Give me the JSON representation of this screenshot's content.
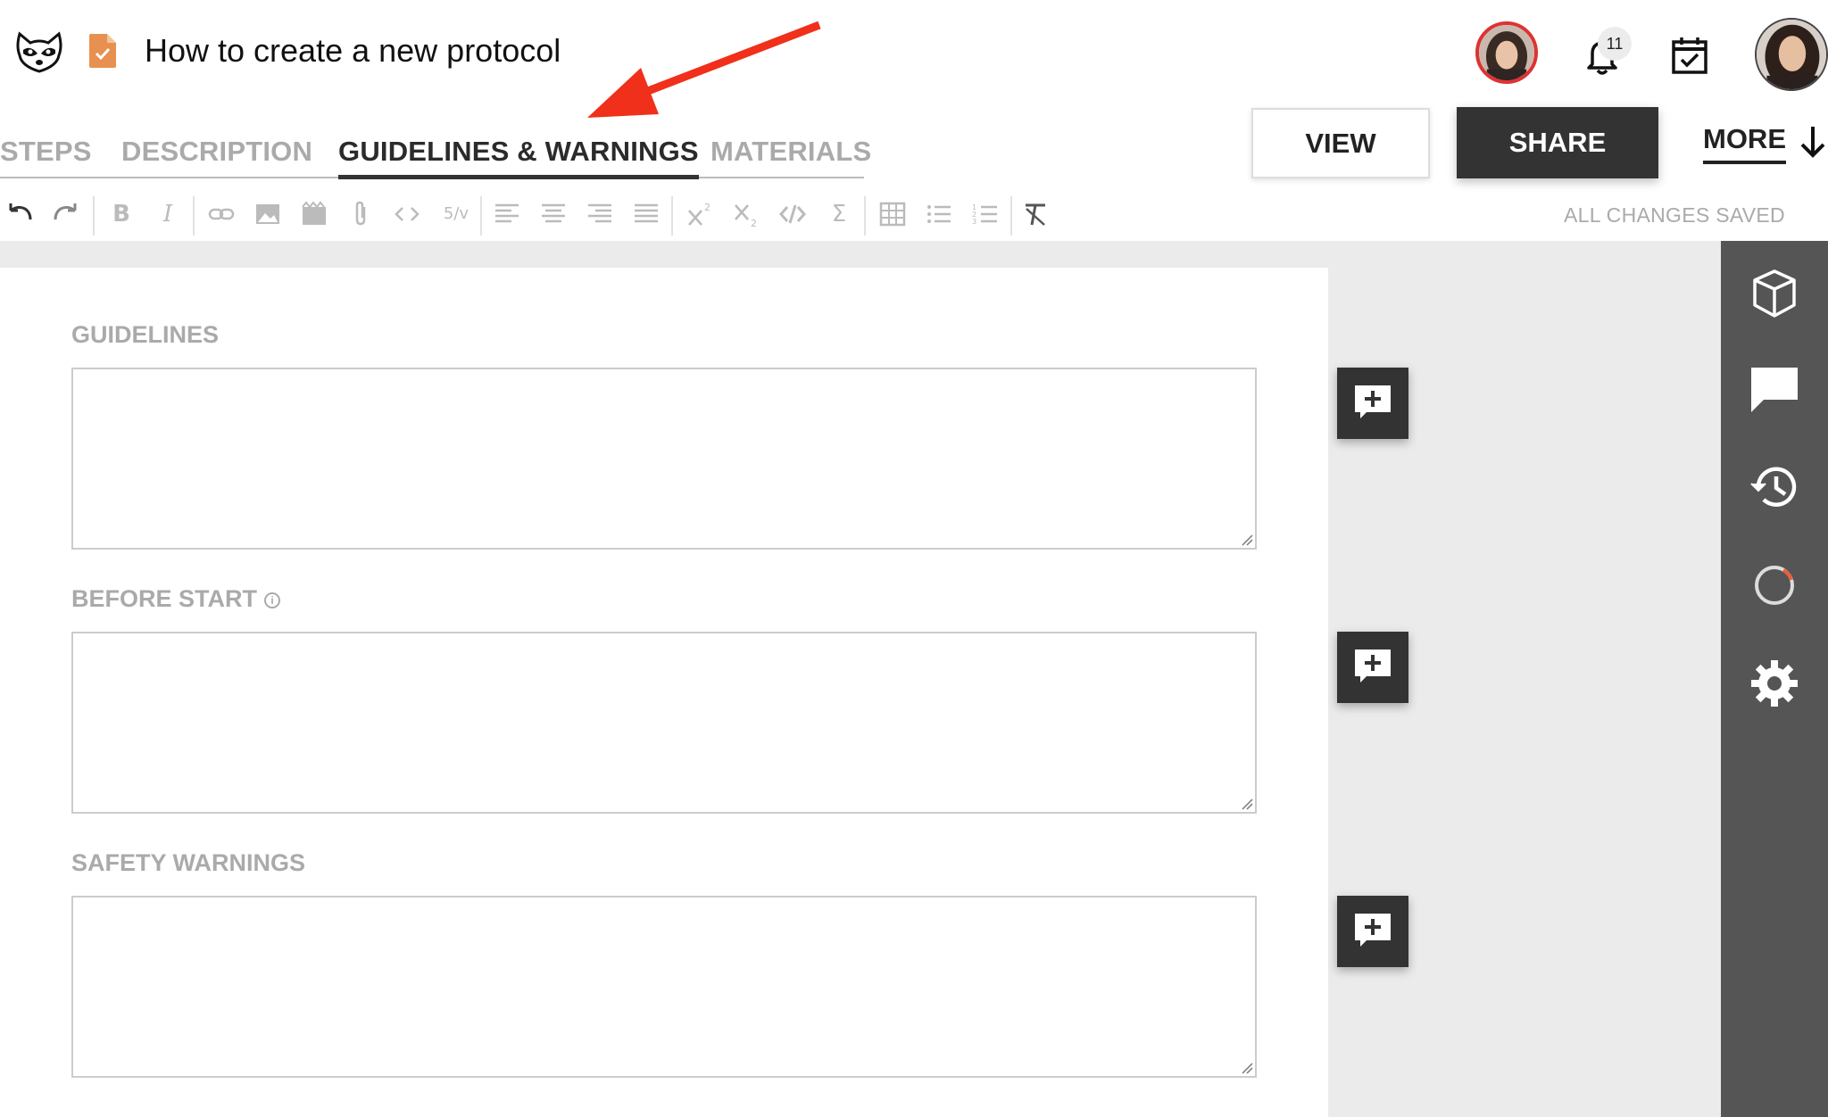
{
  "header": {
    "title": "How to create a new protocol",
    "notification_count": "11"
  },
  "tabs": [
    {
      "label": "STEPS",
      "active": false
    },
    {
      "label": "DESCRIPTION",
      "active": false
    },
    {
      "label": "GUIDELINES & WARNINGS",
      "active": true
    },
    {
      "label": "MATERIALS",
      "active": false
    }
  ],
  "actions": {
    "view_label": "VIEW",
    "share_label": "SHARE",
    "more_label": "MORE"
  },
  "toolbar": {
    "fraction_label": "5/v",
    "status": "ALL CHANGES SAVED"
  },
  "sections": [
    {
      "label": "GUIDELINES",
      "value": ""
    },
    {
      "label": "BEFORE START",
      "value": "",
      "has_info_icon": true
    },
    {
      "label": "SAFETY WARNINGS",
      "value": ""
    }
  ],
  "sidebar": {
    "icons": [
      "materials-box-icon",
      "comments-icon",
      "history-icon",
      "progress-icon",
      "settings-icon"
    ]
  },
  "colors": {
    "accent_dark": "#333333",
    "doc_icon": "#e8904f",
    "annotation_arrow": "#f0301a",
    "avatar_ring": "#dd3333"
  }
}
